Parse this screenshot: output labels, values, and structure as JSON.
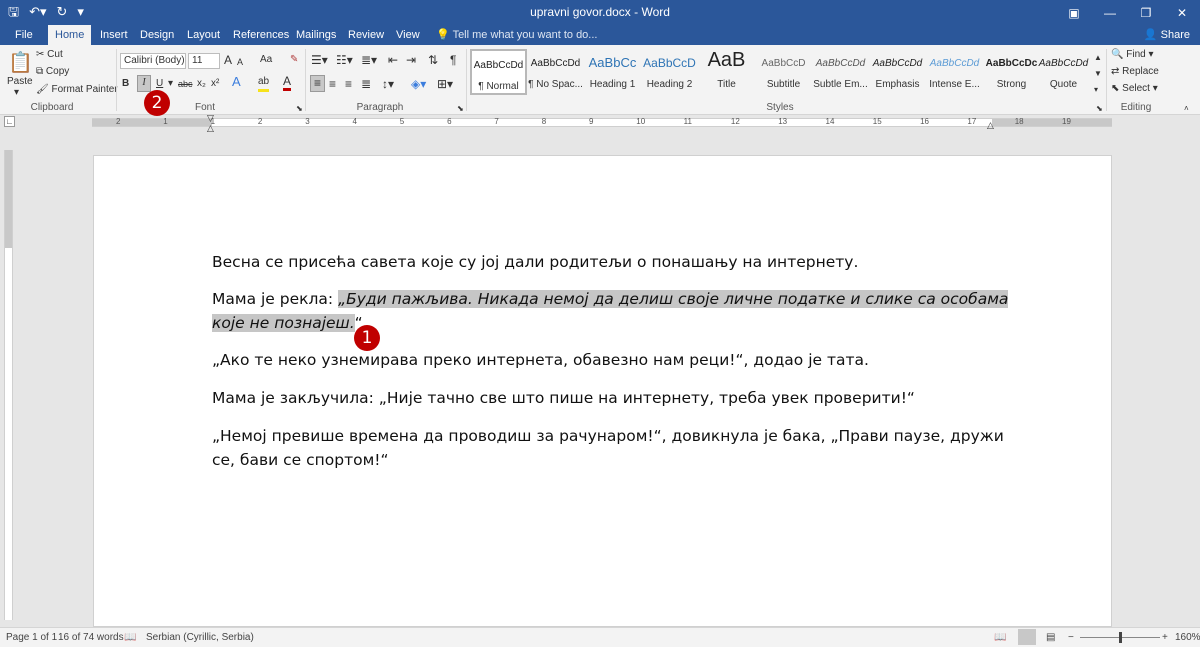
{
  "app": {
    "doc_title": "upravni govor.docx - Word"
  },
  "tabs": [
    "File",
    "Home",
    "Insert",
    "Design",
    "Layout",
    "References",
    "Mailings",
    "Review",
    "View"
  ],
  "tell_me": "Tell me what you want to do...",
  "share": "Share",
  "clipboard": {
    "paste": "Paste",
    "cut": "Cut",
    "copy": "Copy",
    "format_painter": "Format Painter",
    "label": "Clipboard"
  },
  "font": {
    "name": "Calibri (Body)",
    "size": "11",
    "label": "Font",
    "bold": "B",
    "italic": "I",
    "underline": "U",
    "strike": "abc",
    "subscript": "x₂",
    "superscript": "x²",
    "case": "Aa",
    "grow": "A",
    "shrink": "A",
    "effects": "A",
    "highlight": "ab",
    "color": "A"
  },
  "paragraph": {
    "label": "Paragraph"
  },
  "styles": {
    "label": "Styles",
    "items": [
      {
        "sample": "AaBbCcDd",
        "name": "¶ Normal"
      },
      {
        "sample": "AaBbCcDd",
        "name": "¶ No Spac..."
      },
      {
        "sample": "AaBbCc",
        "name": "Heading 1"
      },
      {
        "sample": "AaBbCcD",
        "name": "Heading 2"
      },
      {
        "sample": "AaB",
        "name": "Title"
      },
      {
        "sample": "AaBbCcD",
        "name": "Subtitle"
      },
      {
        "sample": "AaBbCcDd",
        "name": "Subtle Em..."
      },
      {
        "sample": "AaBbCcDd",
        "name": "Emphasis"
      },
      {
        "sample": "AaBbCcDd",
        "name": "Intense E..."
      },
      {
        "sample": "AaBbCcDc",
        "name": "Strong"
      },
      {
        "sample": "AaBbCcDd",
        "name": "Quote"
      }
    ]
  },
  "editing": {
    "find": "Find",
    "replace": "Replace",
    "select": "Select",
    "label": "Editing"
  },
  "callouts": [
    "1",
    "2"
  ],
  "ruler_numbers": [
    "2",
    "1",
    "1",
    "2",
    "3",
    "4",
    "5",
    "6",
    "7",
    "8",
    "9",
    "10",
    "11",
    "12",
    "13",
    "14",
    "15",
    "16",
    "17",
    "18",
    "19"
  ],
  "document": {
    "p1": "Весна се присећа савета које су јој дали родитељи о понашању на интернету.",
    "p2_prefix": "Мама је рекла: ",
    "p2_selected_line1": "„Буди пажљива. Никада  немој да делиш своје личне податке и слике са особама",
    "p2_selected_line2": "које не познајеш.",
    "p2_suffix": "“",
    "p3": " „Ако те неко узнемирава преко интернета, обавезно нам реци!“, додао је тата.",
    "p4": "Мама је закључила: „Није тачно све што пише на интернету, треба увек проверити!“",
    "p5_line1": "„Немој превише времена да проводиш за рачунаром!“, довикнула је бака,  „Прави паузе, дружи",
    "p5_line2": "се, бави се спортом!“"
  },
  "status": {
    "page": "Page 1 of 1",
    "words": "16 of 74 words",
    "language": "Serbian (Cyrillic, Serbia)",
    "zoom": "160%"
  }
}
